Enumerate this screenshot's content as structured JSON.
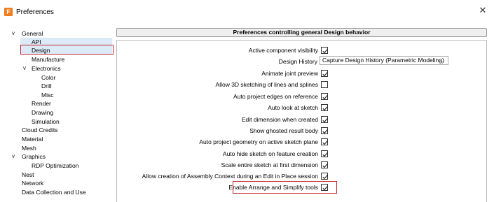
{
  "window": {
    "app_icon_letter": "F",
    "title": "Preferences",
    "close_glyph": "✕"
  },
  "tree": {
    "items": [
      {
        "label": "General",
        "chevron": "v"
      },
      {
        "label": "API"
      },
      {
        "label": "Design"
      },
      {
        "label": "Manufacture"
      },
      {
        "label": "Electronics",
        "chevron": "v"
      },
      {
        "label": "Color"
      },
      {
        "label": "Drill"
      },
      {
        "label": "Misc"
      },
      {
        "label": "Render"
      },
      {
        "label": "Drawing"
      },
      {
        "label": "Simulation"
      },
      {
        "label": "Cloud Credits"
      },
      {
        "label": "Material"
      },
      {
        "label": "Mesh"
      },
      {
        "label": "Graphics",
        "chevron": "v"
      },
      {
        "label": "RDP Optimization"
      },
      {
        "label": "Nest"
      },
      {
        "label": "Network"
      },
      {
        "label": "Data Collection and Use"
      }
    ]
  },
  "panel": {
    "header": "Preferences controlling general Design behavior",
    "options": [
      {
        "label": "Active component visibility",
        "checked": true
      },
      {
        "label": "Design History",
        "type": "select",
        "value": "Capture Design History (Parametric Modeling)"
      },
      {
        "label": "Animate joint preview",
        "checked": true
      },
      {
        "label": "Allow 3D sketching of lines and splines",
        "checked": false
      },
      {
        "label": "Auto project edges on reference",
        "checked": true
      },
      {
        "label": "Auto look at sketch",
        "checked": true
      },
      {
        "label": "Edit dimension when created",
        "checked": true
      },
      {
        "label": "Show ghosted result body",
        "checked": true
      },
      {
        "label": "Auto project geometry on active sketch plane",
        "checked": true
      },
      {
        "label": "Auto hide sketch on feature creation",
        "checked": true
      },
      {
        "label": "Scale entire sketch at first dimension",
        "checked": true
      },
      {
        "label": "Allow creation of Assembly Context during an Edit in Place session",
        "checked": true
      },
      {
        "label": "Enable Arrange and Simplify tools",
        "checked": true
      }
    ]
  },
  "colors": {
    "highlight_border": "#c0282d",
    "selection_bg": "#dce9f7",
    "app_icon": "#f07c1c"
  }
}
